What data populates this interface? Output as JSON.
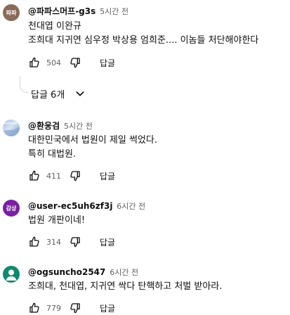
{
  "comments": [
    {
      "avatar_text": "파파",
      "author": "@파파스머프-g3s",
      "time": "5시간 전",
      "lines": [
        "천대엽 이완규",
        "조희대 지귀연 심우정 박상용 엄희준.... 이놈들 처단해야한다"
      ],
      "likes": "504",
      "reply_label": "답글",
      "replies_toggle": "답글 6개"
    },
    {
      "author": "@환웅검",
      "time": "5시간 전",
      "lines": [
        "대한민국에서 법원이 제일 썩었다.",
        "특히 대법원."
      ],
      "likes": "411",
      "reply_label": "답글"
    },
    {
      "avatar_text": "감상",
      "author": "@user-ec5uh6zf3j",
      "time": "6시간 전",
      "lines": [
        "법원 개판이네!"
      ],
      "likes": "314",
      "reply_label": "답글"
    },
    {
      "author": "@ogsuncho2547",
      "time": "6시간 전",
      "lines": [
        "조희대, 천대엽, 지귀연 싹다 탄핵하고 처벌 받아라."
      ],
      "likes": "779",
      "reply_label": "답글"
    }
  ],
  "colors": {
    "avatar_1": "#8a6a58",
    "avatar_3": "#7b1fa2",
    "avatar_4": "#0f8a6e",
    "meta_text": "#606060"
  }
}
